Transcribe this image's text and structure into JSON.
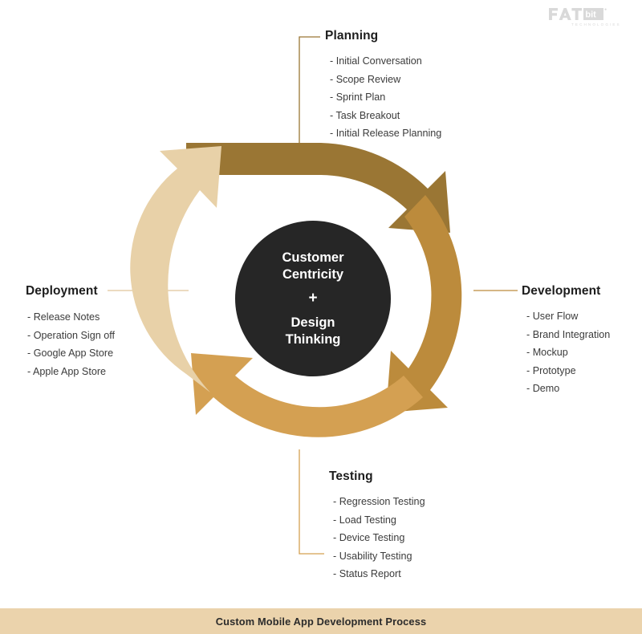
{
  "brand": {
    "logo_primary": "FAT",
    "logo_accent": "bit",
    "logo_tagline": "TECHNOLOGIES"
  },
  "center": {
    "line1": "Customer",
    "line2": "Centricity",
    "plus": "+",
    "line3": "Design",
    "line4": "Thinking"
  },
  "footer": {
    "caption": "Custom Mobile App Development Process",
    "background": "#EBD3AC"
  },
  "colors": {
    "planning_arc": "#9A7634",
    "development_arc": "#BC8B3C",
    "testing_arc": "#D4A052",
    "deployment_arc": "#E8D1A8",
    "center_circle": "#262626",
    "page_background": "#FFFFFF",
    "text_dark": "#1D1D1D",
    "text_body": "#3B3B3B",
    "logo_gray": "#D9D9D9"
  },
  "stages": [
    {
      "id": "planning",
      "title": "Planning",
      "color": "#9A7634",
      "items": [
        "- Initial Conversation",
        "- Scope Review",
        "- Sprint Plan",
        "- Task Breakout",
        "- Initial Release Planning"
      ]
    },
    {
      "id": "development",
      "title": "Development",
      "color": "#BC8B3C",
      "items": [
        "- User Flow",
        "- Brand Integration",
        "- Mockup",
        "- Prototype",
        "- Demo"
      ]
    },
    {
      "id": "testing",
      "title": "Testing",
      "color": "#D4A052",
      "items": [
        "- Regression Testing",
        "- Load Testing",
        "- Device Testing",
        "- Usability Testing",
        "- Status Report"
      ]
    },
    {
      "id": "deployment",
      "title": "Deployment",
      "color": "#E8D1A8",
      "items": [
        "- Release Notes",
        "- Operation Sign off",
        "- Google App Store",
        "- Apple App Store"
      ]
    }
  ]
}
